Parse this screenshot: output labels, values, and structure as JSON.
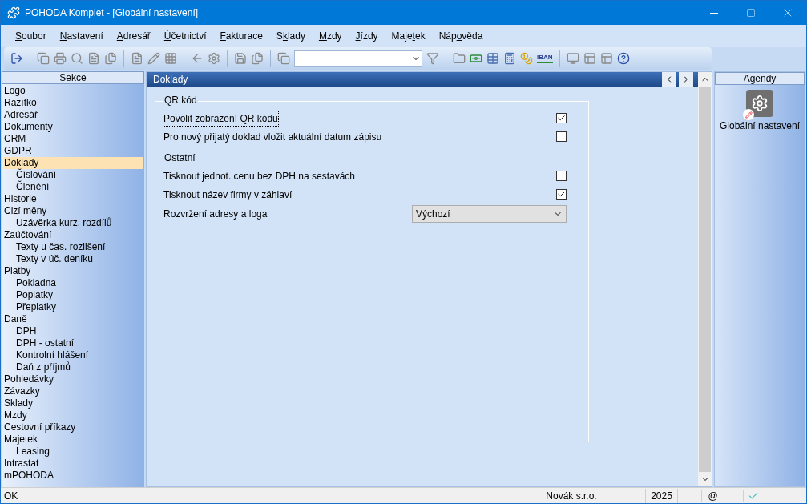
{
  "window": {
    "title": "POHODA Komplet - [Globální nastavení]"
  },
  "menu": [
    {
      "key": "S",
      "rest": "oubor"
    },
    {
      "key": "N",
      "rest": "astavení"
    },
    {
      "key": "A",
      "rest": "dresář"
    },
    {
      "key": "Ú",
      "rest": "četnictví"
    },
    {
      "key": "F",
      "rest": "akturace"
    },
    {
      "lead": "S",
      "key": "k",
      "rest": "lady"
    },
    {
      "key": "M",
      "rest": "zdy"
    },
    {
      "key": "J",
      "rest": "ízdy"
    },
    {
      "lead": "Maje",
      "key": "t",
      "rest": "ek"
    },
    {
      "lead": "Náp",
      "key": "o",
      "rest": "věda"
    }
  ],
  "toolbar": {
    "iban_label": "IBAN"
  },
  "sidebar": {
    "title": "Sekce",
    "items": [
      {
        "label": "Logo",
        "selected": false
      },
      {
        "label": "Razítko",
        "selected": false
      },
      {
        "label": "Adresář",
        "selected": false
      },
      {
        "label": "Dokumenty",
        "selected": false
      },
      {
        "label": "CRM",
        "selected": false
      },
      {
        "label": "GDPR",
        "selected": false
      },
      {
        "label": "Doklady",
        "selected": true,
        "children": [
          {
            "label": "Číslování",
            "selected": false
          },
          {
            "label": "Členění",
            "selected": false
          }
        ]
      },
      {
        "label": "Historie",
        "selected": false
      },
      {
        "label": "Cizí měny",
        "selected": false,
        "children": [
          {
            "label": "Uzávěrka kurz. rozdílů",
            "selected": false
          }
        ]
      },
      {
        "label": "Zaúčtování",
        "selected": false,
        "children": [
          {
            "label": "Texty u čas. rozlišení",
            "selected": false
          },
          {
            "label": "Texty v úč. deníku",
            "selected": false
          }
        ]
      },
      {
        "label": "Platby",
        "selected": false,
        "children": [
          {
            "label": "Pokladna",
            "selected": false
          },
          {
            "label": "Poplatky",
            "selected": false
          },
          {
            "label": "Přeplatky",
            "selected": false
          }
        ]
      },
      {
        "label": "Daně",
        "selected": false,
        "children": [
          {
            "label": "DPH",
            "selected": false
          },
          {
            "label": "DPH - ostatní",
            "selected": false
          },
          {
            "label": "Kontrolní hlášení",
            "selected": false
          },
          {
            "label": "Daň z příjmů",
            "selected": false
          }
        ]
      },
      {
        "label": "Pohledávky",
        "selected": false
      },
      {
        "label": "Závazky",
        "selected": false
      },
      {
        "label": "Sklady",
        "selected": false
      },
      {
        "label": "Mzdy",
        "selected": false
      },
      {
        "label": "Cestovní příkazy",
        "selected": false
      },
      {
        "label": "Majetek",
        "selected": false,
        "children": [
          {
            "label": "Leasing",
            "selected": false
          }
        ]
      },
      {
        "label": "Intrastat",
        "selected": false
      },
      {
        "label": "mPOHODA",
        "selected": false
      }
    ]
  },
  "panel": {
    "title": "Doklady",
    "groups": [
      {
        "title": "QR kód",
        "rows": [
          {
            "kind": "checkbox",
            "label": "Povolit zobrazení QR kódu",
            "checked": true,
            "focused": true
          },
          {
            "kind": "checkbox",
            "label": "Pro nový přijatý doklad vložit aktuální datum zápisu",
            "checked": false,
            "focused": false
          }
        ]
      },
      {
        "title": "Ostatní",
        "rows": [
          {
            "kind": "checkbox",
            "label": "Tisknout jednot. cenu bez DPH na sestavách",
            "checked": false,
            "focused": false
          },
          {
            "kind": "checkbox",
            "label": "Tisknout název firmy v záhlaví",
            "checked": true,
            "focused": false
          },
          {
            "kind": "select",
            "label": "Rozvržení adresy a loga",
            "value": "Výchozí"
          }
        ]
      }
    ]
  },
  "agendas": {
    "title": "Agendy",
    "items": [
      {
        "label": "Globální nastavení"
      }
    ]
  },
  "status_bar": {
    "message": "OK",
    "company": "Novák s.r.o.",
    "year": "2025",
    "email_mark": "@"
  }
}
